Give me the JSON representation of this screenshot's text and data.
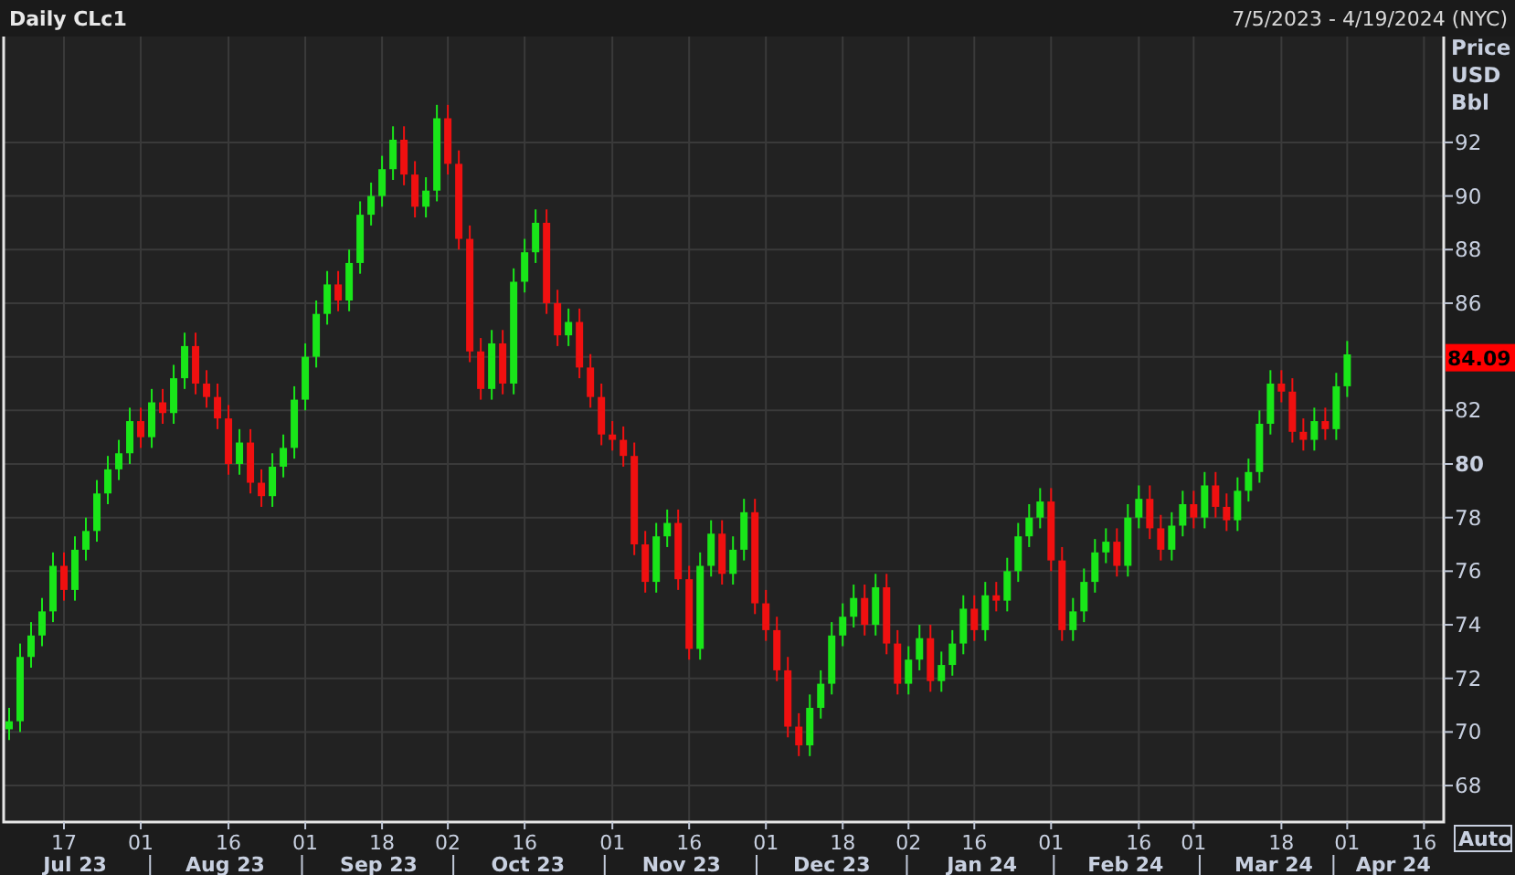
{
  "header": {
    "title": "Daily CLc1",
    "date_range": "7/5/2023 - 4/19/2024 (NYC)"
  },
  "chart": {
    "chart_data": {
      "type": "candlestick",
      "grid": true,
      "ylabel": "Price USD Bbl",
      "ylim": [
        66.64,
        95.95
      ],
      "yticks": [
        92,
        90,
        88,
        86,
        82,
        80,
        78,
        76,
        74,
        72,
        70,
        68
      ],
      "categories": [
        null,
        null,
        null,
        null,
        null,
        "17",
        null,
        null,
        null,
        null,
        null,
        null,
        "01",
        null,
        null,
        null,
        null,
        null,
        null,
        null,
        "16",
        null,
        null,
        null,
        null,
        null,
        null,
        "01",
        null,
        null,
        null,
        null,
        null,
        null,
        "18",
        null,
        null,
        null,
        null,
        null,
        "02",
        null,
        null,
        null,
        null,
        null,
        null,
        "16",
        null,
        null,
        null,
        null,
        null,
        null,
        null,
        "01",
        null,
        null,
        null,
        null,
        null,
        null,
        "16",
        null,
        null,
        null,
        null,
        null,
        null,
        "01",
        null,
        null,
        null,
        null,
        null,
        null,
        "18",
        null,
        null,
        null,
        null,
        null,
        "02",
        null,
        null,
        null,
        null,
        null,
        "16",
        null,
        null,
        null,
        null,
        null,
        null,
        "01",
        null,
        null,
        null,
        null,
        null,
        null,
        null,
        "16",
        null,
        null,
        null,
        null,
        "01",
        null,
        null,
        null,
        null,
        null,
        null,
        null,
        "18",
        null,
        null,
        null,
        null,
        null,
        "01",
        null,
        null,
        null,
        null,
        null,
        null,
        "16"
      ],
      "ohlc": [
        [
          70.1,
          70.9,
          69.7,
          70.4
        ],
        [
          70.4,
          73.3,
          70.0,
          72.8
        ],
        [
          72.8,
          74.1,
          72.4,
          73.6
        ],
        [
          73.6,
          75.0,
          73.2,
          74.5
        ],
        [
          74.5,
          76.7,
          74.1,
          76.2
        ],
        [
          76.2,
          76.7,
          74.9,
          75.3
        ],
        [
          75.3,
          77.3,
          74.9,
          76.8
        ],
        [
          76.8,
          78.0,
          76.4,
          77.5
        ],
        [
          77.5,
          79.4,
          77.1,
          78.9
        ],
        [
          78.9,
          80.3,
          78.5,
          79.8
        ],
        [
          79.8,
          80.9,
          79.4,
          80.4
        ],
        [
          80.4,
          82.1,
          80.0,
          81.6
        ],
        [
          81.6,
          82.1,
          80.6,
          81.0
        ],
        [
          81.0,
          82.8,
          80.6,
          82.3
        ],
        [
          82.3,
          82.8,
          81.5,
          81.9
        ],
        [
          81.9,
          83.7,
          81.5,
          83.2
        ],
        [
          83.2,
          84.9,
          82.8,
          84.4
        ],
        [
          84.4,
          84.9,
          82.6,
          83.0
        ],
        [
          83.0,
          83.5,
          82.1,
          82.5
        ],
        [
          82.5,
          83.0,
          81.3,
          81.7
        ],
        [
          81.7,
          82.2,
          79.6,
          80.0
        ],
        [
          80.0,
          81.3,
          79.6,
          80.8
        ],
        [
          80.8,
          81.3,
          78.9,
          79.3
        ],
        [
          79.3,
          79.8,
          78.4,
          78.8
        ],
        [
          78.8,
          80.4,
          78.4,
          79.9
        ],
        [
          79.9,
          81.1,
          79.5,
          80.6
        ],
        [
          80.6,
          82.9,
          80.2,
          82.4
        ],
        [
          82.4,
          84.5,
          82.0,
          84.0
        ],
        [
          84.0,
          86.1,
          83.6,
          85.6
        ],
        [
          85.6,
          87.2,
          85.2,
          86.7
        ],
        [
          86.7,
          87.2,
          85.7,
          86.1
        ],
        [
          86.1,
          88.0,
          85.7,
          87.5
        ],
        [
          87.5,
          89.8,
          87.1,
          89.3
        ],
        [
          89.3,
          90.5,
          88.9,
          90.0
        ],
        [
          90.0,
          91.5,
          89.6,
          91.0
        ],
        [
          91.0,
          92.6,
          90.6,
          92.1
        ],
        [
          92.1,
          92.6,
          90.4,
          90.8
        ],
        [
          90.8,
          91.3,
          89.2,
          89.6
        ],
        [
          89.6,
          90.7,
          89.2,
          90.2
        ],
        [
          90.2,
          93.4,
          89.8,
          92.9
        ],
        [
          92.9,
          93.4,
          90.8,
          91.2
        ],
        [
          91.2,
          91.7,
          88.0,
          88.4
        ],
        [
          88.4,
          88.9,
          83.8,
          84.2
        ],
        [
          84.2,
          84.7,
          82.4,
          82.8
        ],
        [
          82.8,
          85.0,
          82.4,
          84.5
        ],
        [
          84.5,
          85.0,
          82.6,
          83.0
        ],
        [
          83.0,
          87.3,
          82.6,
          86.8
        ],
        [
          86.8,
          88.4,
          86.4,
          87.9
        ],
        [
          87.9,
          89.5,
          87.5,
          89.0
        ],
        [
          89.0,
          89.5,
          85.6,
          86.0
        ],
        [
          86.0,
          86.5,
          84.4,
          84.8
        ],
        [
          84.8,
          85.8,
          84.4,
          85.3
        ],
        [
          85.3,
          85.8,
          83.2,
          83.6
        ],
        [
          83.6,
          84.1,
          82.1,
          82.5
        ],
        [
          82.5,
          83.0,
          80.7,
          81.1
        ],
        [
          81.1,
          81.6,
          80.5,
          80.9
        ],
        [
          80.9,
          81.4,
          79.9,
          80.3
        ],
        [
          80.3,
          80.8,
          76.6,
          77.0
        ],
        [
          77.0,
          77.5,
          75.2,
          75.6
        ],
        [
          75.6,
          77.8,
          75.2,
          77.3
        ],
        [
          77.3,
          78.3,
          76.9,
          77.8
        ],
        [
          77.8,
          78.3,
          75.3,
          75.7
        ],
        [
          75.7,
          76.2,
          72.7,
          73.1
        ],
        [
          73.1,
          76.7,
          72.7,
          76.2
        ],
        [
          76.2,
          77.9,
          75.8,
          77.4
        ],
        [
          77.4,
          77.9,
          75.5,
          75.9
        ],
        [
          75.9,
          77.3,
          75.5,
          76.8
        ],
        [
          76.8,
          78.7,
          76.4,
          78.2
        ],
        [
          78.2,
          78.7,
          74.4,
          74.8
        ],
        [
          74.8,
          75.3,
          73.4,
          73.8
        ],
        [
          73.8,
          74.3,
          71.9,
          72.3
        ],
        [
          72.3,
          72.8,
          69.8,
          70.2
        ],
        [
          70.2,
          70.7,
          69.1,
          69.5
        ],
        [
          69.5,
          71.4,
          69.1,
          70.9
        ],
        [
          70.9,
          72.3,
          70.5,
          71.8
        ],
        [
          71.8,
          74.1,
          71.4,
          73.6
        ],
        [
          73.6,
          74.8,
          73.2,
          74.3
        ],
        [
          74.3,
          75.5,
          73.9,
          75.0
        ],
        [
          75.0,
          75.5,
          73.6,
          74.0
        ],
        [
          74.0,
          75.9,
          73.6,
          75.4
        ],
        [
          75.4,
          75.9,
          72.9,
          73.3
        ],
        [
          73.3,
          73.8,
          71.4,
          71.8
        ],
        [
          71.8,
          73.2,
          71.4,
          72.7
        ],
        [
          72.7,
          74.0,
          72.3,
          73.5
        ],
        [
          73.5,
          74.0,
          71.5,
          71.9
        ],
        [
          71.9,
          73.0,
          71.5,
          72.5
        ],
        [
          72.5,
          73.8,
          72.1,
          73.3
        ],
        [
          73.3,
          75.1,
          72.9,
          74.6
        ],
        [
          74.6,
          75.1,
          73.4,
          73.8
        ],
        [
          73.8,
          75.6,
          73.4,
          75.1
        ],
        [
          75.1,
          75.6,
          74.5,
          74.9
        ],
        [
          74.9,
          76.5,
          74.5,
          76.0
        ],
        [
          76.0,
          77.8,
          75.6,
          77.3
        ],
        [
          77.3,
          78.5,
          76.9,
          78.0
        ],
        [
          78.0,
          79.1,
          77.6,
          78.6
        ],
        [
          78.6,
          79.1,
          76.0,
          76.4
        ],
        [
          76.4,
          76.9,
          73.4,
          73.8
        ],
        [
          73.8,
          75.0,
          73.4,
          74.5
        ],
        [
          74.5,
          76.1,
          74.1,
          75.6
        ],
        [
          75.6,
          77.2,
          75.2,
          76.7
        ],
        [
          76.7,
          77.6,
          76.3,
          77.1
        ],
        [
          77.1,
          77.6,
          75.8,
          76.2
        ],
        [
          76.2,
          78.5,
          75.8,
          78.0
        ],
        [
          78.0,
          79.2,
          77.6,
          78.7
        ],
        [
          78.7,
          79.2,
          77.2,
          77.6
        ],
        [
          77.6,
          78.1,
          76.4,
          76.8
        ],
        [
          76.8,
          78.2,
          76.4,
          77.7
        ],
        [
          77.7,
          79.0,
          77.3,
          78.5
        ],
        [
          78.5,
          79.0,
          77.6,
          78.0
        ],
        [
          78.0,
          79.7,
          77.6,
          79.2
        ],
        [
          79.2,
          79.7,
          78.0,
          78.4
        ],
        [
          78.4,
          78.9,
          77.5,
          77.9
        ],
        [
          77.9,
          79.5,
          77.5,
          79.0
        ],
        [
          79.0,
          80.2,
          78.6,
          79.7
        ],
        [
          79.7,
          82.0,
          79.3,
          81.5
        ],
        [
          81.5,
          83.5,
          81.1,
          83.0
        ],
        [
          83.0,
          83.5,
          82.3,
          82.7
        ],
        [
          82.7,
          83.2,
          80.8,
          81.2
        ],
        [
          81.2,
          81.7,
          80.5,
          80.9
        ],
        [
          80.9,
          82.1,
          80.5,
          81.6
        ],
        [
          81.6,
          82.1,
          80.9,
          81.3
        ],
        [
          81.3,
          83.4,
          80.9,
          82.9
        ],
        [
          82.9,
          84.59,
          82.5,
          84.09
        ],
        null,
        null,
        null,
        null,
        null,
        null,
        null
      ]
    },
    "ytick_emphasis": [
      false,
      false,
      false,
      false,
      false,
      true,
      false,
      false,
      false,
      false,
      false,
      false
    ],
    "last_price": "84.09",
    "scale_button": "Auto",
    "months": [
      "Jul 23",
      "Aug 23",
      "Sep 23",
      "Oct 23",
      "Nov 23",
      "Dec 23",
      "Jan 24",
      "Feb 24",
      "Mar 24",
      "Apr 24"
    ]
  }
}
